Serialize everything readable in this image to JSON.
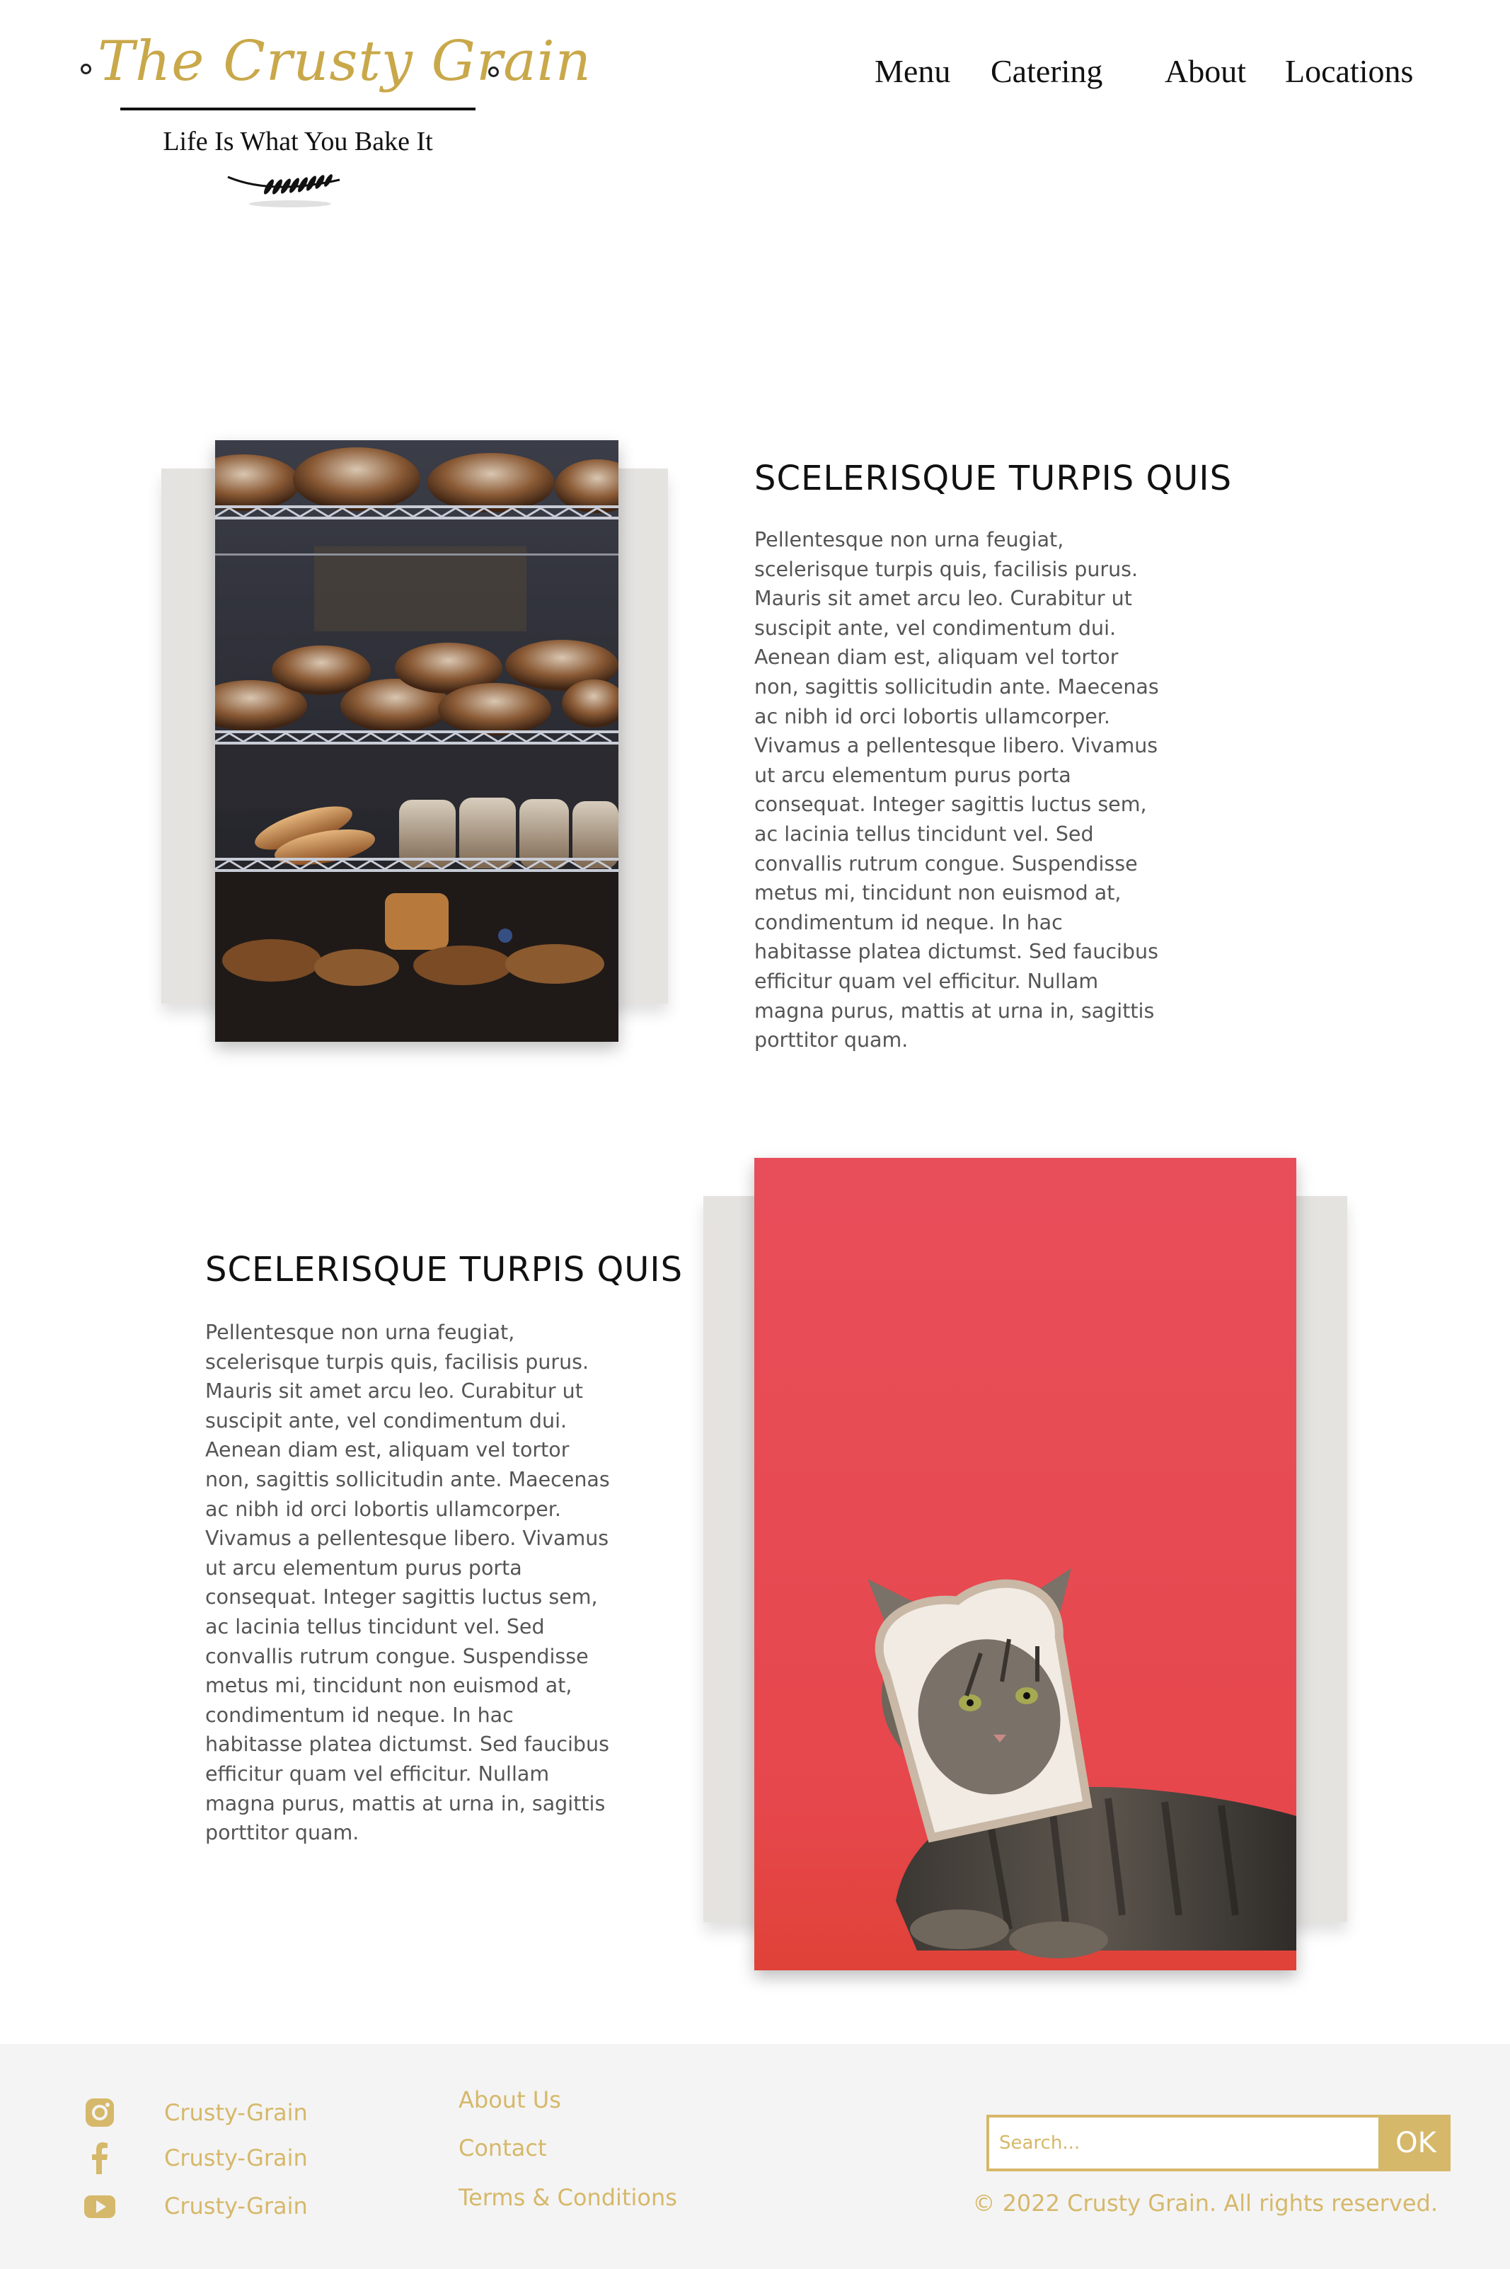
{
  "brand": {
    "name": "The Crusty Grain",
    "tagline": "Life Is What You Bake It",
    "accent_color": "#c9a84a"
  },
  "nav": {
    "items": [
      {
        "label": "Menu"
      },
      {
        "label": "Catering"
      },
      {
        "label": "About"
      },
      {
        "label": "Locations"
      }
    ]
  },
  "sections": [
    {
      "title": "SCELERISQUE TURPIS QUIS",
      "body": "Pellentesque non urna feugiat, scelerisque turpis quis, facilisis purus. Mauris sit amet arcu leo. Curabitur ut suscipit ante, vel condimentum dui. Aenean diam est, aliquam vel tortor non, sagittis sollicitudin ante. Maecenas ac nibh id orci lobortis ullamcorper. Vivamus a pellentesque libero. Vivamus ut arcu elementum purus porta consequat. Integer sagittis luctus sem, ac lacinia tellus tincidunt vel. Sed convallis rutrum congue. Suspendisse metus mi, tincidunt non euismod at, condimentum id neque. In hac habitasse platea dictumst. Sed faucibus efficitur quam vel efficitur. Nullam magna purus, mattis at urna in, sagittis porttitor quam.",
      "image_icon": "bread-shelves-photo"
    },
    {
      "title": "SCELERISQUE TURPIS QUIS",
      "body": "Pellentesque non urna feugiat, scelerisque turpis quis, facilisis purus. Mauris sit amet arcu leo. Curabitur ut suscipit ante, vel condimentum dui. Aenean diam est, aliquam vel tortor non, sagittis sollicitudin ante. Maecenas ac nibh id orci lobortis ullamcorper. Vivamus a pellentesque libero. Vivamus ut arcu elementum purus porta consequat. Integer sagittis luctus sem, ac lacinia tellus tincidunt vel. Sed convallis rutrum congue. Suspendisse metus mi, tincidunt non euismod at, condimentum id neque. In hac habitasse platea dictumst. Sed faucibus efficitur quam vel efficitur. Nullam magna purus, mattis at urna in, sagittis porttitor quam.",
      "image_icon": "cat-bread-photo"
    }
  ],
  "footer": {
    "social": [
      {
        "icon": "instagram-icon",
        "label": "Crusty-Grain"
      },
      {
        "icon": "facebook-icon",
        "label": "Crusty-Grain"
      },
      {
        "icon": "youtube-icon",
        "label": "Crusty-Grain"
      }
    ],
    "links": [
      {
        "label": "About Us"
      },
      {
        "label": "Contact"
      },
      {
        "label": "Terms & Conditions"
      }
    ],
    "search": {
      "placeholder": "Search...",
      "value": "",
      "button_label": "OK"
    },
    "copyright": "© 2022 Crusty Grain. All rights reserved.",
    "accent_color": "#d6b86a",
    "background_color": "#f4f4f4"
  }
}
